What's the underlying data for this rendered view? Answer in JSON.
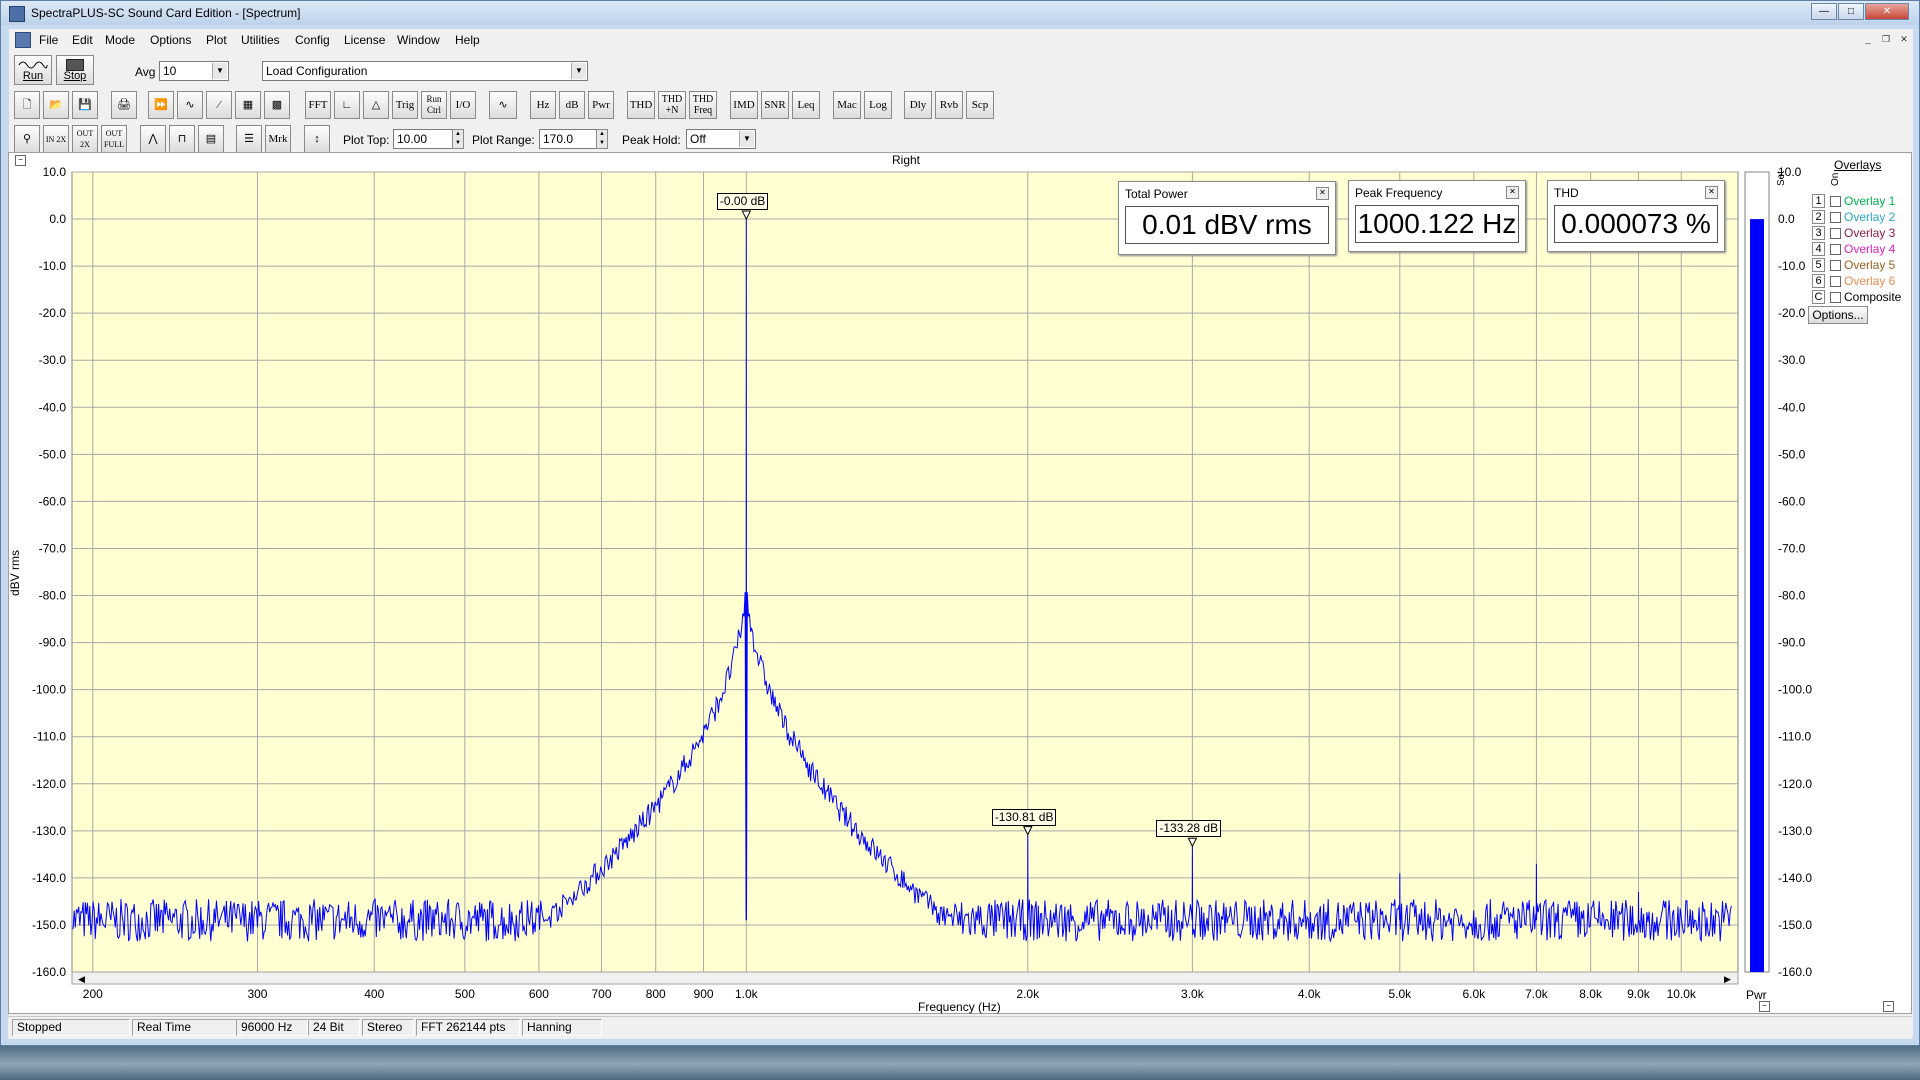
{
  "app": {
    "title": "SpectraPLUS-SC Sound Card Edition - [Spectrum]",
    "menu": [
      "File",
      "Edit",
      "Mode",
      "Options",
      "Plot",
      "Utilities",
      "Config",
      "License",
      "Window",
      "Help"
    ]
  },
  "toolbar1": {
    "run_label": "Run",
    "stop_label": "Stop",
    "avg_label": "Avg",
    "avg_value": "10",
    "config_value": "Load Configuration"
  },
  "toolbar2": {
    "buttons": [
      "FFT",
      "Trig",
      "Run Ctrl",
      "I/O",
      "Hz",
      "dB",
      "Pwr",
      "THD",
      "THD +N",
      "THD Freq",
      "IMD",
      "SNR",
      "Leq",
      "Mac",
      "Log",
      "Dly",
      "Rvb",
      "Scp"
    ]
  },
  "toolbar3": {
    "mrk_label": "Mrk",
    "plot_top_label": "Plot Top:",
    "plot_top_value": "10.00",
    "plot_range_label": "Plot Range:",
    "plot_range_value": "170.0",
    "peak_hold_label": "Peak Hold:",
    "peak_hold_value": "Off"
  },
  "plot": {
    "channel": "Right",
    "y_axis_label": "dBV rms",
    "x_axis_label": "Frequency (Hz)",
    "right_bar_label": "Pwr"
  },
  "meters": [
    {
      "title": "Total Power",
      "value": "0.01 dBV rms"
    },
    {
      "title": "Peak Frequency",
      "value": "1000.122 Hz"
    },
    {
      "title": "THD",
      "value": "0.000073 %"
    }
  ],
  "overlays": {
    "title": "Overlays",
    "col_set": "Set",
    "col_on": "On",
    "options_label": "Options...",
    "items": [
      {
        "key": "1",
        "label": "Overlay 1",
        "color": "#00b050"
      },
      {
        "key": "2",
        "label": "Overlay 2",
        "color": "#2aa6c8"
      },
      {
        "key": "3",
        "label": "Overlay 3",
        "color": "#8b1a4e"
      },
      {
        "key": "4",
        "label": "Overlay 4",
        "color": "#e020c0"
      },
      {
        "key": "5",
        "label": "Overlay 5",
        "color": "#9a6020"
      },
      {
        "key": "6",
        "label": "Overlay 6",
        "color": "#e88b4c"
      },
      {
        "key": "C",
        "label": "Composite",
        "color": "#000000"
      }
    ]
  },
  "status": [
    "Stopped",
    "Real Time",
    "96000 Hz",
    "24 Bit",
    "Stereo",
    "FFT 262144 pts",
    "Hanning"
  ],
  "chart_data": {
    "type": "line",
    "title": "Right",
    "xlabel": "Frequency (Hz)",
    "ylabel": "dBV rms",
    "x_scale": "log",
    "xlim": [
      190,
      11500
    ],
    "ylim": [
      -160,
      10
    ],
    "y_ticks": [
      "10.0",
      "0.0",
      "-10.0",
      "-20.0",
      "-30.0",
      "-40.0",
      "-50.0",
      "-60.0",
      "-70.0",
      "-80.0",
      "-90.0",
      "-100.0",
      "-110.0",
      "-120.0",
      "-130.0",
      "-140.0",
      "-150.0",
      "-160.0"
    ],
    "x_ticks": [
      {
        "value": 200,
        "label": "200"
      },
      {
        "value": 300,
        "label": "300"
      },
      {
        "value": 400,
        "label": "400"
      },
      {
        "value": 500,
        "label": "500"
      },
      {
        "value": 600,
        "label": "600"
      },
      {
        "value": 700,
        "label": "700"
      },
      {
        "value": 800,
        "label": "800"
      },
      {
        "value": 900,
        "label": "900"
      },
      {
        "value": 1000,
        "label": "1.0k"
      },
      {
        "value": 2000,
        "label": "2.0k"
      },
      {
        "value": 3000,
        "label": "3.0k"
      },
      {
        "value": 4000,
        "label": "4.0k"
      },
      {
        "value": 5000,
        "label": "5.0k"
      },
      {
        "value": 6000,
        "label": "6.0k"
      },
      {
        "value": 7000,
        "label": "7.0k"
      },
      {
        "value": 8000,
        "label": "8.0k"
      },
      {
        "value": 9000,
        "label": "9.0k"
      },
      {
        "value": 10000,
        "label": "10.0k"
      }
    ],
    "grid": true,
    "noise_floor": -149,
    "series": [
      {
        "color": "#0000ff",
        "peaks": [
          {
            "x": 1000,
            "y": 0.0
          },
          {
            "x": 2000,
            "y": -130.81
          },
          {
            "x": 3000,
            "y": -133.28
          },
          {
            "x": 5000,
            "y": -139
          },
          {
            "x": 7000,
            "y": -137
          },
          {
            "x": 9000,
            "y": -143
          }
        ]
      }
    ],
    "markers": [
      {
        "x": 1000,
        "y": 0.0,
        "label": "-0.00 dB"
      },
      {
        "x": 2000,
        "y": -130.81,
        "label": "-130.81 dB"
      },
      {
        "x": 3000,
        "y": -133.28,
        "label": "-133.28 dB"
      }
    ],
    "power_bar": {
      "value": -0.01,
      "color": "#0000ff"
    }
  }
}
